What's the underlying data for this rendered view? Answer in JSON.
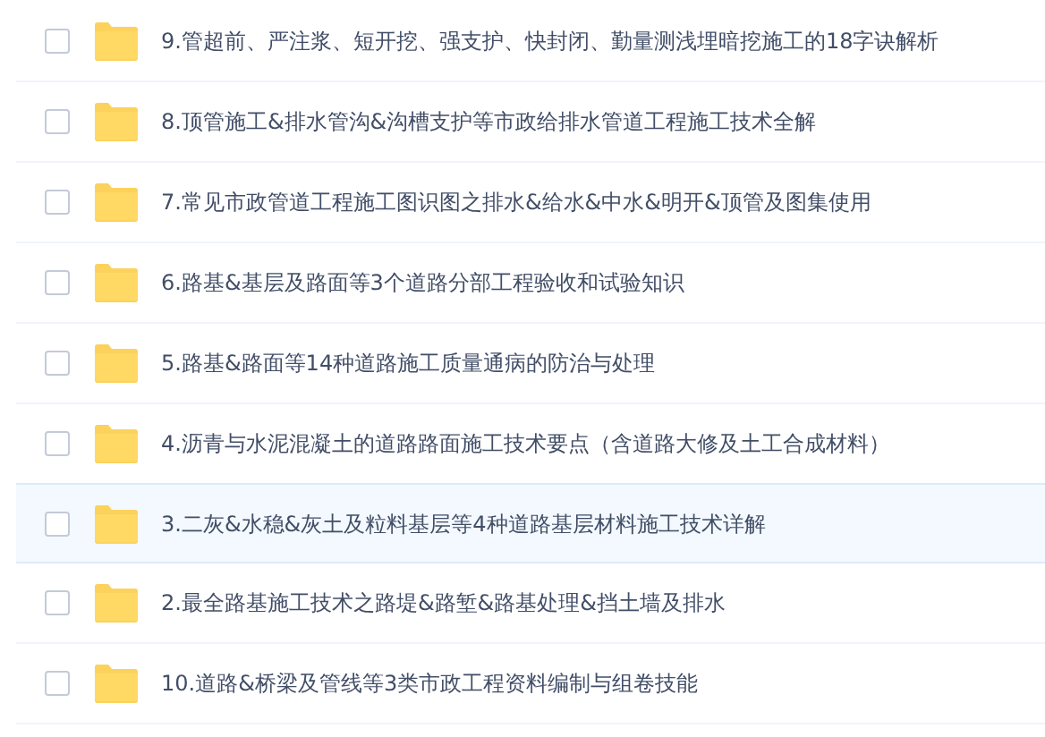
{
  "files": [
    {
      "name": "9.管超前、严注浆、短开挖、强支护、快封闭、勤量测浅埋暗挖施工的18字诀解析",
      "checked": false,
      "highlighted": false
    },
    {
      "name": "8.顶管施工&排水管沟&沟槽支护等市政给排水管道工程施工技术全解",
      "checked": false,
      "highlighted": false
    },
    {
      "name": "7.常见市政管道工程施工图识图之排水&给水&中水&明开&顶管及图集使用",
      "checked": false,
      "highlighted": false
    },
    {
      "name": "6.路基&基层及路面等3个道路分部工程验收和试验知识",
      "checked": false,
      "highlighted": false
    },
    {
      "name": "5.路基&路面等14种道路施工质量通病的防治与处理",
      "checked": false,
      "highlighted": false
    },
    {
      "name": "4.沥青与水泥混凝土的道路路面施工技术要点（含道路大修及土工合成材料）",
      "checked": false,
      "highlighted": false
    },
    {
      "name": "3.二灰&水稳&灰土及粒料基层等4种道路基层材料施工技术详解",
      "checked": false,
      "highlighted": true
    },
    {
      "name": "2.最全路基施工技术之路堤&路堑&路基处理&挡土墙及排水",
      "checked": false,
      "highlighted": false
    },
    {
      "name": "10.道路&桥梁及管线等3类市政工程资料编制与组卷技能",
      "checked": false,
      "highlighted": false
    }
  ]
}
